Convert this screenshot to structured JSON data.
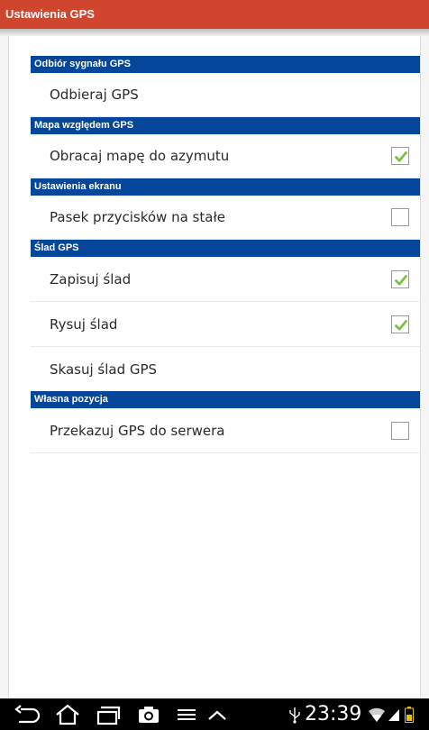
{
  "window": {
    "title": "Ustawienia GPS"
  },
  "sections": [
    {
      "header": "Odbiór sygnału GPS",
      "items": [
        {
          "label": "Odbieraj GPS",
          "has_checkbox": false
        }
      ]
    },
    {
      "header": "Mapa względem GPS",
      "items": [
        {
          "label": "Obracaj mapę do azymutu",
          "has_checkbox": true,
          "checked": true
        }
      ]
    },
    {
      "header": "Ustawienia ekranu",
      "items": [
        {
          "label": "Pasek przycisków na stałe",
          "has_checkbox": true,
          "checked": false
        }
      ]
    },
    {
      "header": "Ślad GPS",
      "items": [
        {
          "label": "Zapisuj ślad",
          "has_checkbox": true,
          "checked": true
        },
        {
          "label": "Rysuj ślad",
          "has_checkbox": true,
          "checked": true
        },
        {
          "label": "Skasuj ślad GPS",
          "has_checkbox": false
        }
      ]
    },
    {
      "header": "Własna pozycja",
      "items": [
        {
          "label": "Przekazuj GPS do serwera",
          "has_checkbox": true,
          "checked": false
        }
      ]
    }
  ],
  "status_bar": {
    "time": "23:39",
    "icons": [
      "back-icon",
      "home-icon",
      "recent-apps-icon",
      "camera-icon",
      "menu-icon",
      "chevron-up-icon",
      "usb-icon",
      "wifi-icon",
      "signal-icon",
      "battery-icon"
    ]
  },
  "colors": {
    "title_bar": "#d0452d",
    "section_header": "#04479a",
    "checkmark": "#7bc143",
    "background": "#f5f5f5"
  }
}
